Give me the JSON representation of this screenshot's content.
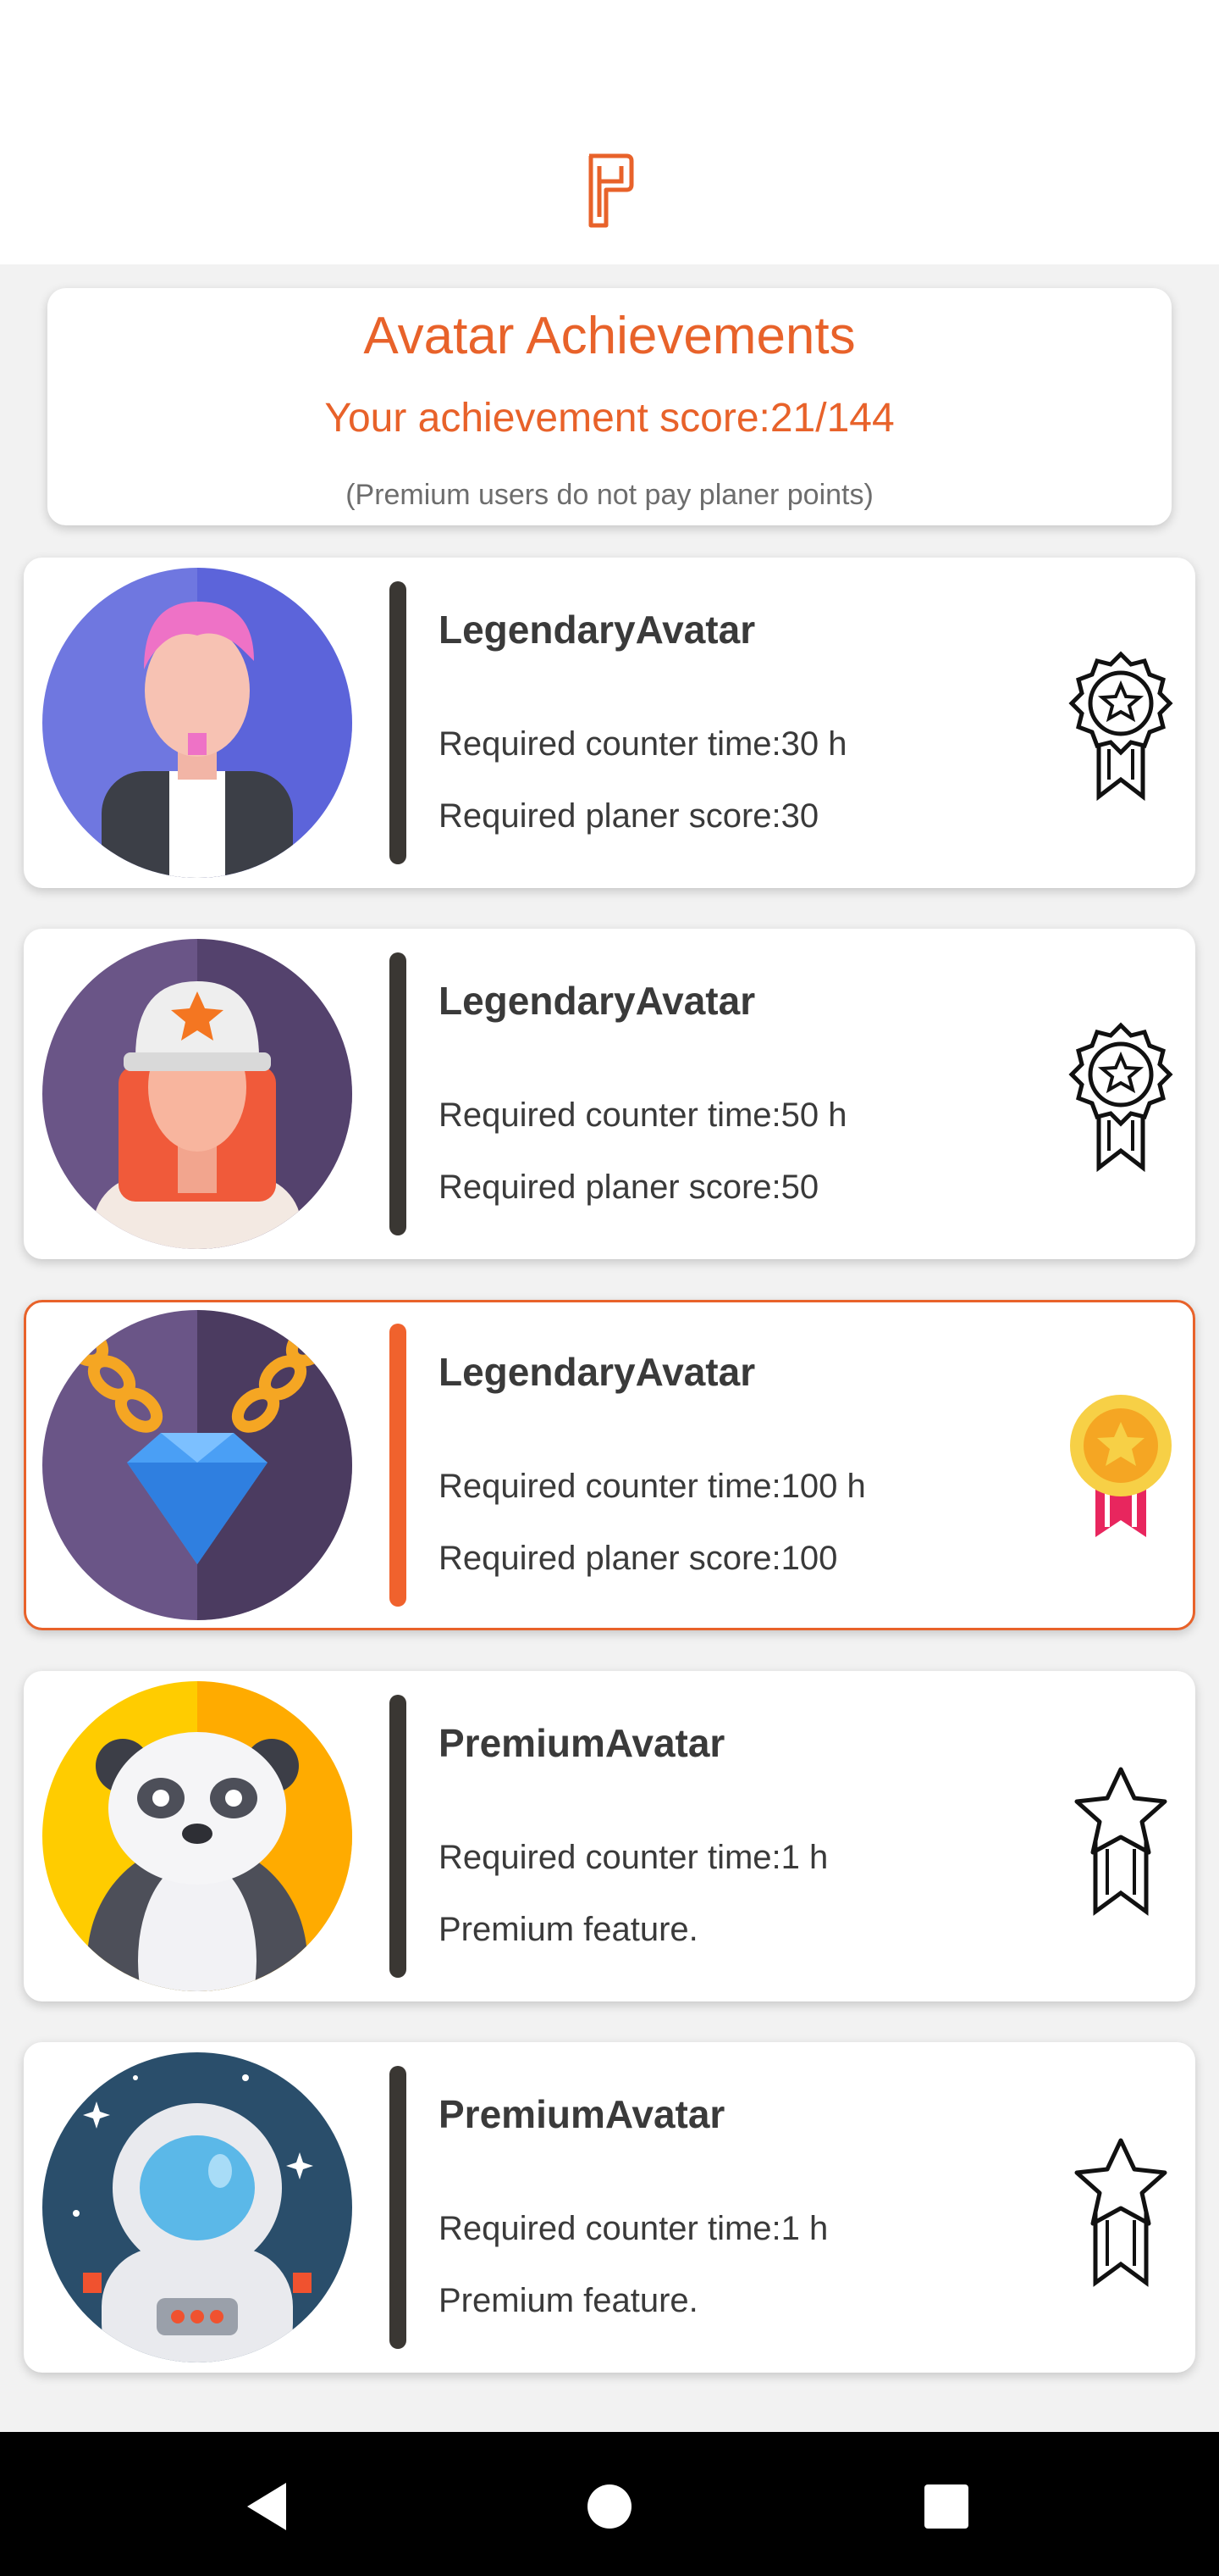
{
  "header": {
    "title": "Avatar Achievements",
    "score": "Your achievement score:21/144",
    "note": "(Premium users do not pay planer points)"
  },
  "colors": {
    "accent": "#e8622a",
    "divider": "#3a3733",
    "text": "#3a3a3a"
  },
  "cards": [
    {
      "title": "LegendaryAvatar",
      "line1": "Required counter time:30 h",
      "line2": "Required planer score:30",
      "avatar": "pink-hair-man-avatar",
      "badge": "outline-award-ribbon-icon",
      "selected": false
    },
    {
      "title": "LegendaryAvatar",
      "line1": "Required counter time:50 h",
      "line2": "Required planer score:50",
      "avatar": "cap-girl-avatar",
      "badge": "outline-award-ribbon-icon",
      "selected": false
    },
    {
      "title": "LegendaryAvatar",
      "line1": "Required counter time:100 h",
      "line2": "Required planer score:100",
      "avatar": "diamond-chain-avatar",
      "badge": "gold-medal-icon",
      "selected": true
    },
    {
      "title": "PremiumAvatar",
      "line1": "Required counter time:1 h",
      "line2": "Premium feature.",
      "avatar": "panda-avatar",
      "badge": "outline-star-ribbon-icon",
      "selected": false
    },
    {
      "title": "PremiumAvatar",
      "line1": "Required counter time:1 h",
      "line2": "Premium feature.",
      "avatar": "astronaut-avatar",
      "badge": "outline-star-ribbon-icon",
      "selected": false
    }
  ],
  "navigation": {
    "back": "back-triangle-icon",
    "home": "home-circle-icon",
    "recents": "recents-square-icon"
  }
}
